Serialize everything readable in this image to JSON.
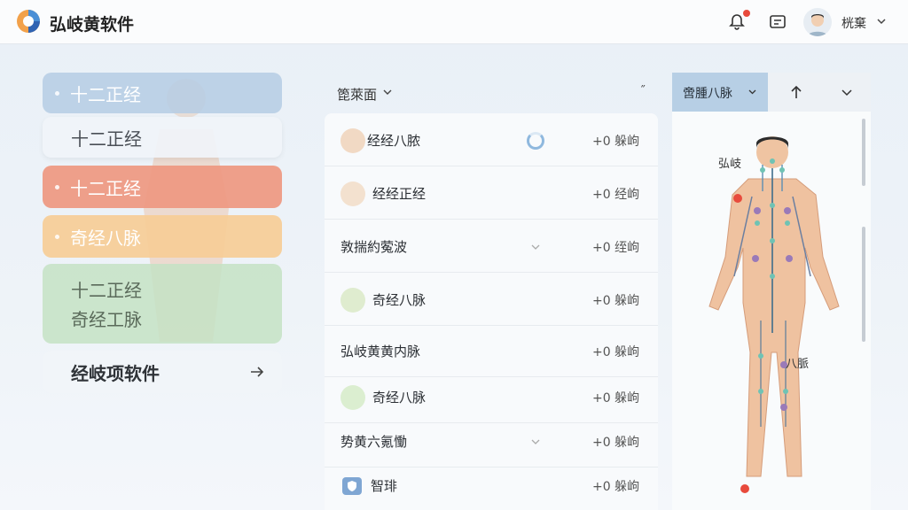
{
  "header": {
    "title": "弘岐黄软件",
    "user_name": "桄棄",
    "icons": [
      "app-logo-icon",
      "bell-icon",
      "message-icon",
      "chevron-down-icon"
    ]
  },
  "sidebar": {
    "items": [
      {
        "label": "十二正经"
      },
      {
        "label": "十二正经"
      },
      {
        "label": "十二正经"
      },
      {
        "label": "奇经八脉"
      },
      {
        "label": "十二正经",
        "label2": "奇经工脉"
      },
      {
        "label": "经岐项软件"
      }
    ]
  },
  "list": {
    "header_label": "箆萊面",
    "corner_mark": "˝",
    "rows": [
      {
        "name": "经经八脓",
        "value": "+0 躲岣"
      },
      {
        "name": "经经正经",
        "value": "+0 经岣"
      },
      {
        "name": "敦揣約蒬波",
        "value": "+0 绖岣"
      },
      {
        "name": "奇经八脉",
        "value": "+0 躲岣"
      },
      {
        "name": "弘岐黄黄内脉",
        "value": "+0 躲岣"
      },
      {
        "name": "奇经八脉",
        "value": "+0 躲岣"
      },
      {
        "name": "势黄六氪慟",
        "value": "+0 躲岣"
      },
      {
        "name": "智琲",
        "value": "+0 躲岣"
      }
    ]
  },
  "right_panel": {
    "tab_label": "啻腫八脉",
    "labels": [
      "弘岐",
      "八脈"
    ]
  },
  "colors": {
    "accent_blue": "#b7cfe5",
    "coral": "#ee9880",
    "orange": "#f6cd96",
    "green": "#c4e2c4",
    "alert_red": "#e84a3c"
  }
}
